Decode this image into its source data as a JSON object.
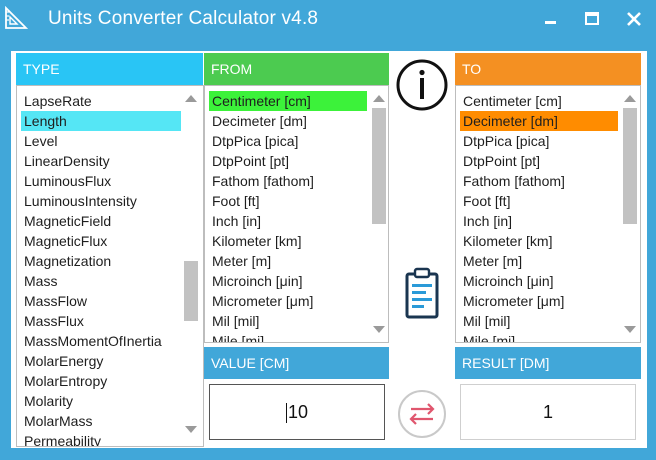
{
  "window": {
    "title": "Units Converter Calculator v4.8",
    "controls": [
      "minimize",
      "maximize",
      "close"
    ]
  },
  "type_panel": {
    "header": "TYPE",
    "selected": "Length",
    "items": [
      "LapseRate",
      "Length",
      "Level",
      "LinearDensity",
      "LuminousFlux",
      "LuminousIntensity",
      "MagneticField",
      "MagneticFlux",
      "Magnetization",
      "Mass",
      "MassFlow",
      "MassFlux",
      "MassMomentOfInertia",
      "MolarEnergy",
      "MolarEntropy",
      "Molarity",
      "MolarMass",
      "Permeability"
    ]
  },
  "from_panel": {
    "header": "FROM",
    "selected": "Centimeter [cm]",
    "items": [
      "Centimeter [cm]",
      "Decimeter [dm]",
      "DtpPica [pica]",
      "DtpPoint [pt]",
      "Fathom [fathom]",
      "Foot [ft]",
      "Inch [in]",
      "Kilometer [km]",
      "Meter [m]",
      "Microinch [μin]",
      "Micrometer [μm]",
      "Mil [mil]",
      "Mile [mi]"
    ]
  },
  "to_panel": {
    "header": "TO",
    "selected": "Decimeter [dm]",
    "items": [
      "Centimeter [cm]",
      "Decimeter [dm]",
      "DtpPica [pica]",
      "DtpPoint [pt]",
      "Fathom [fathom]",
      "Foot [ft]",
      "Inch [in]",
      "Kilometer [km]",
      "Meter [m]",
      "Microinch [μin]",
      "Micrometer [μm]",
      "Mil [mil]",
      "Mile [mi]"
    ]
  },
  "value": {
    "header": "VALUE [CM]",
    "text": "10"
  },
  "result": {
    "header": "RESULT [DM]",
    "text": "1"
  },
  "icons": {
    "app": "ruler-triangle-icon",
    "info": "info-icon",
    "clipboard": "clipboard-icon",
    "swap": "swap-arrows-icon"
  },
  "colors": {
    "window": "#41a7d9",
    "type_header": "#29c5f5",
    "from_header": "#4ccb50",
    "to_header": "#f49022",
    "type_selected": "#55e6f5",
    "from_selected": "#3cf23a",
    "to_selected": "#ff8c00"
  }
}
